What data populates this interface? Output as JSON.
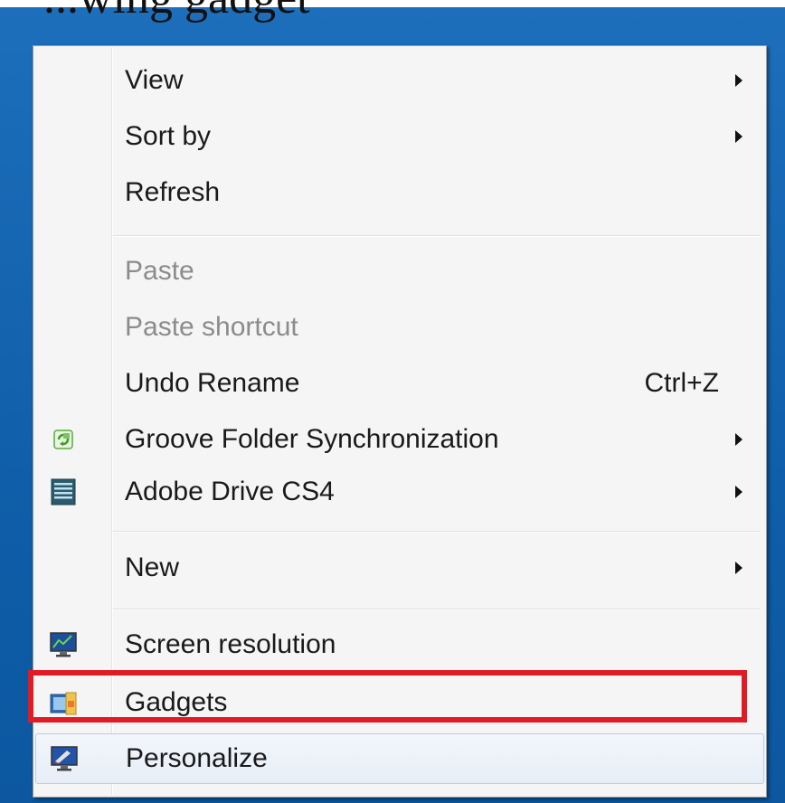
{
  "header": {
    "top_text": "...wing gadget"
  },
  "menu": {
    "items": {
      "view": {
        "label": "View"
      },
      "sort_by": {
        "label": "Sort by"
      },
      "refresh": {
        "label": "Refresh"
      },
      "paste": {
        "label": "Paste"
      },
      "paste_shortcut": {
        "label": "Paste shortcut"
      },
      "undo_rename": {
        "label": "Undo Rename",
        "shortcut": "Ctrl+Z"
      },
      "groove": {
        "label": "Groove Folder Synchronization",
        "icon": "groove-sync-icon"
      },
      "adobe_drive": {
        "label": "Adobe Drive CS4",
        "icon": "adobe-drive-icon"
      },
      "new": {
        "label": "New"
      },
      "screen_resolution": {
        "label": "Screen resolution",
        "icon": "monitor-icon"
      },
      "gadgets": {
        "label": "Gadgets",
        "icon": "gadgets-icon"
      },
      "personalize": {
        "label": "Personalize",
        "icon": "personalize-icon"
      }
    }
  },
  "colors": {
    "desktop_blue": "#1d6fbb",
    "highlight_red": "#e01b24",
    "disabled_text": "#8c8c8c"
  }
}
